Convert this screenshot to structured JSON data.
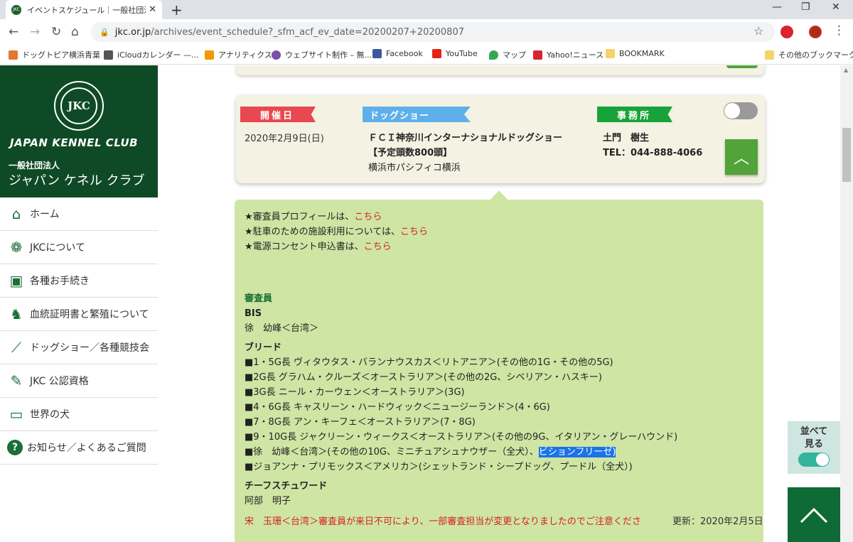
{
  "browser": {
    "tab_title": "イベントスケジュール｜一般社団法人",
    "url_domain": "jkc.or.jp",
    "url_path": "/archives/event_schedule?_sfm_acf_ev_date=20200207+20200807",
    "bookmarks": [
      "ドッグトピア横浜青葉",
      "iCloudカレンダー —...",
      "アナリティクス",
      "ウェブサイト制作 – 無...",
      "Facebook",
      "YouTube",
      "マップ",
      "Yahoo!ニュース",
      "BOOKMARK",
      "その他のブックマーク"
    ]
  },
  "logo": {
    "circle": "JKC",
    "en": "JAPAN KENNEL CLUB",
    "jp_small": "一般社団法人",
    "jp_big": "ジャパン ケネル クラブ"
  },
  "nav": [
    {
      "label": "ホーム",
      "icon": "house-icon"
    },
    {
      "label": "JKCについて",
      "icon": "paw-icon"
    },
    {
      "label": "各種お手続き",
      "icon": "id-card-icon"
    },
    {
      "label": "血統証明書と繁殖について",
      "icon": "dog-icon"
    },
    {
      "label": "ドッグショー／各種競技会",
      "icon": "bone-icon"
    },
    {
      "label": "JKC 公認資格",
      "icon": "pen-icon"
    },
    {
      "label": "世界の犬",
      "icon": "book-icon"
    },
    {
      "label": "お知らせ／よくあるご質問",
      "icon": "question-icon"
    }
  ],
  "event": {
    "date_label": "開催日",
    "date": "2020年2月9日(日)",
    "show_label": "ドッグショー",
    "show_name": "ＦＣＩ神奈川インターナショナルドッグショー",
    "show_entries": "【予定頭数800頭】",
    "show_venue": "横浜市パシフィコ横浜",
    "office_label": "事務所",
    "office_name": "土門　樹生",
    "office_tel": "TEL：044-888-4066"
  },
  "details": {
    "notes": [
      {
        "prefix": "★審査員プロフィールは、",
        "link": "こちら"
      },
      {
        "prefix": "★駐車のための施設利用については、",
        "link": "こちら"
      },
      {
        "prefix": "★電源コンセント申込書は、",
        "link": "こちら"
      }
    ],
    "judges_heading": "審査員",
    "bis_label": "BIS",
    "bis_judge": "徐　幼峰＜台湾＞",
    "breed_heading": "ブリード",
    "breed_lines": [
      "■1・5G長 ヴィタウタス・バランナウスカス＜リトアニア＞(その他の1G・その他の5G)",
      "■2G長 グラハム・クルーズ＜オーストラリア＞(その他の2G、シベリアン・ハスキー)",
      "■3G長 ニール・カーウェン＜オーストラリア＞(3G)",
      "■4・6G長 キャスリーン・ハードウィック＜ニュージーランド＞(4・6G)",
      "■7・8G長 アン・キーフェ＜オーストラリア＞(7・8G)",
      "■9・10G長 ジャクリーン・ウィークス＜オーストラリア＞(その他の9G、イタリアン・グレーハウンド)"
    ],
    "breed_line_hl_prefix": "■徐　幼峰＜台湾＞(その他の10G、ミニチュアシュナウザー（全犬）、",
    "breed_line_hl_selected": "ビションフリーゼ)",
    "breed_line_last": "■ジョアンナ・プリモックス＜アメリカ＞(シェットランド・シープドッグ、プードル（全犬）)",
    "steward_heading": "チーフスチュワード",
    "steward_name": "阿部　明子",
    "warning": "宋　玉珊＜台湾＞審査員が来日不可により、一部審査担当が変更となりましたのでご注意くださ",
    "updated": "更新：2020年2月5日"
  },
  "side_widget": {
    "line1": "並べて",
    "line2": "見る"
  },
  "colors": {
    "brand_green": "#0f4a26",
    "panel_green": "#cfe5a4",
    "ribbon_red": "#e8484f",
    "ribbon_blue": "#5fb0ea",
    "ribbon_green": "#17a33a",
    "link_red": "#d62020"
  }
}
